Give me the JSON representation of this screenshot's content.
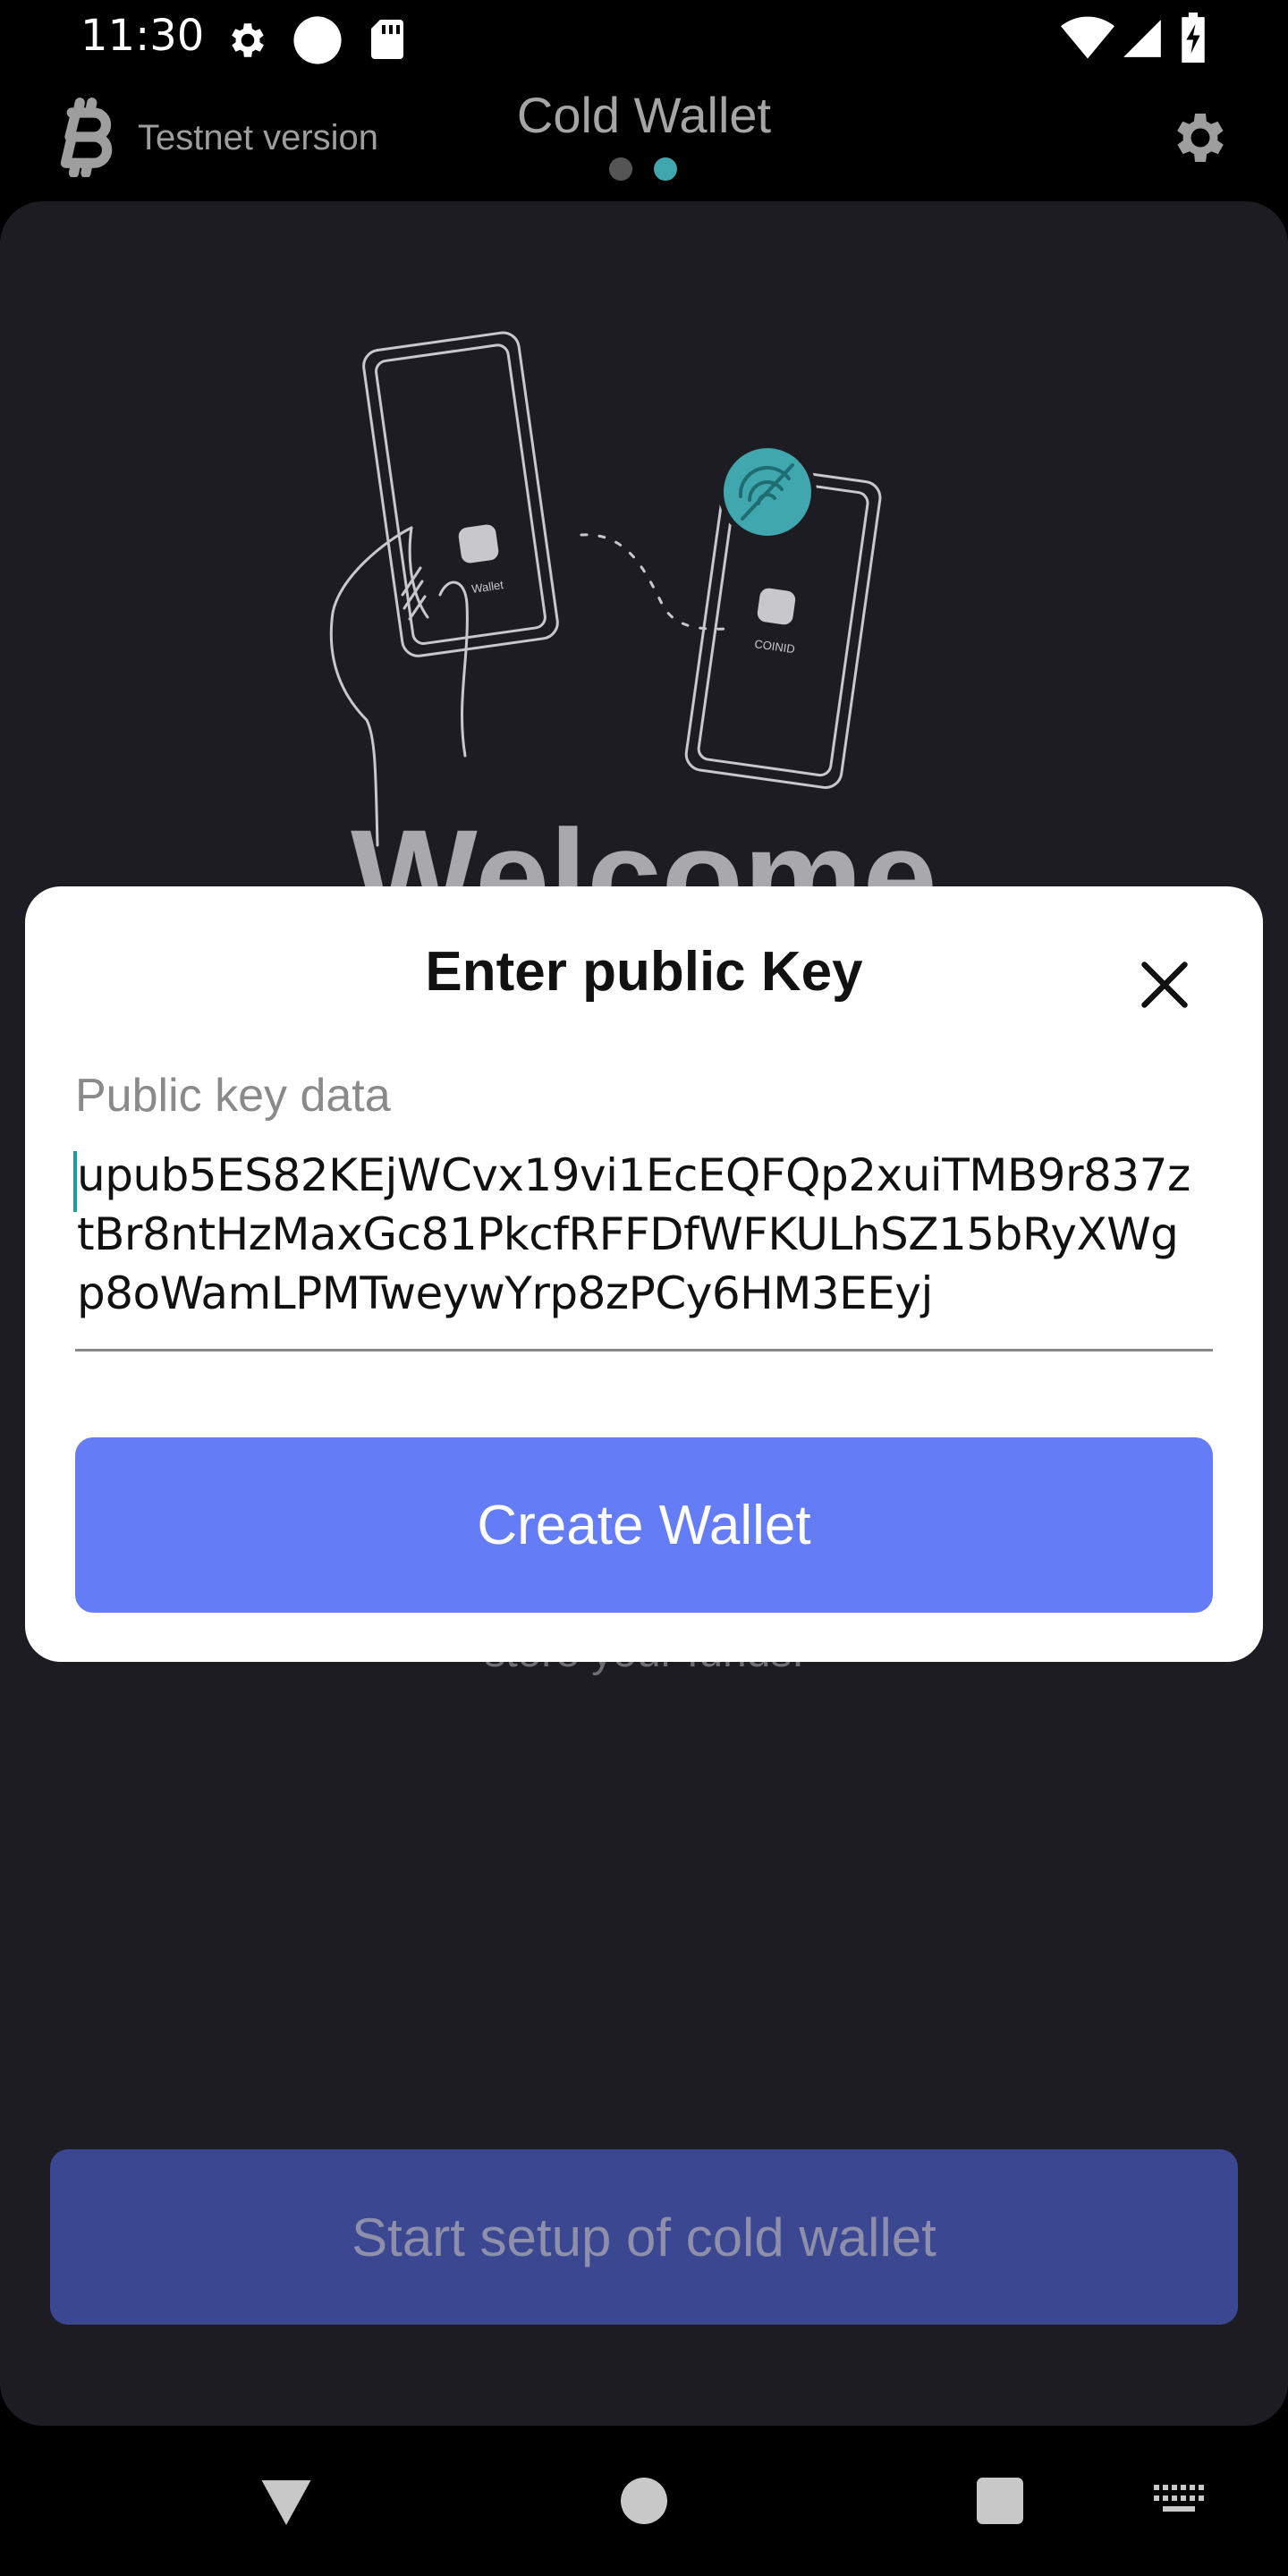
{
  "status_bar": {
    "time": "11:30",
    "icons": [
      "gear-icon",
      "circle-icon",
      "sd-card-icon",
      "wifi-icon",
      "signal-icon",
      "battery-charging-icon"
    ]
  },
  "header": {
    "logo": "bitcoin-logo-icon",
    "network_label": "Testnet version",
    "title": "Cold Wallet",
    "settings_icon": "gear-icon",
    "pager": {
      "count": 2,
      "active_index": 1
    }
  },
  "main": {
    "illustration": {
      "left_phone_label": "Wallet",
      "right_phone_label": "COINID",
      "badge_icon": "no-signal-icon"
    },
    "welcome_heading": "Welcome",
    "description_tail": "store your funds.",
    "start_button_label": "Start setup of cold wallet"
  },
  "modal": {
    "title": "Enter public Key",
    "close_icon": "close-icon",
    "field_label": "Public key data",
    "field_value_lines": [
      "upub5ES82KEjWCvx19vi1EcEQFQp2xuiTMB9r837z",
      "tBr8ntHzMaxGc81PkcfRFFDfWFKULhSZ15bRyXWg",
      "p8oWamLPMTweywYrp8zPCy6HM3EEyj"
    ],
    "create_button_label": "Create Wallet"
  },
  "nav_bar": {
    "buttons": [
      "back-icon",
      "home-icon",
      "recents-icon",
      "keyboard-icon"
    ]
  },
  "colors": {
    "accent": "#647cf6",
    "accent_dimmed": "#3b4790",
    "teal": "#3fa7ad",
    "panel_bg": "#1c1c22"
  }
}
